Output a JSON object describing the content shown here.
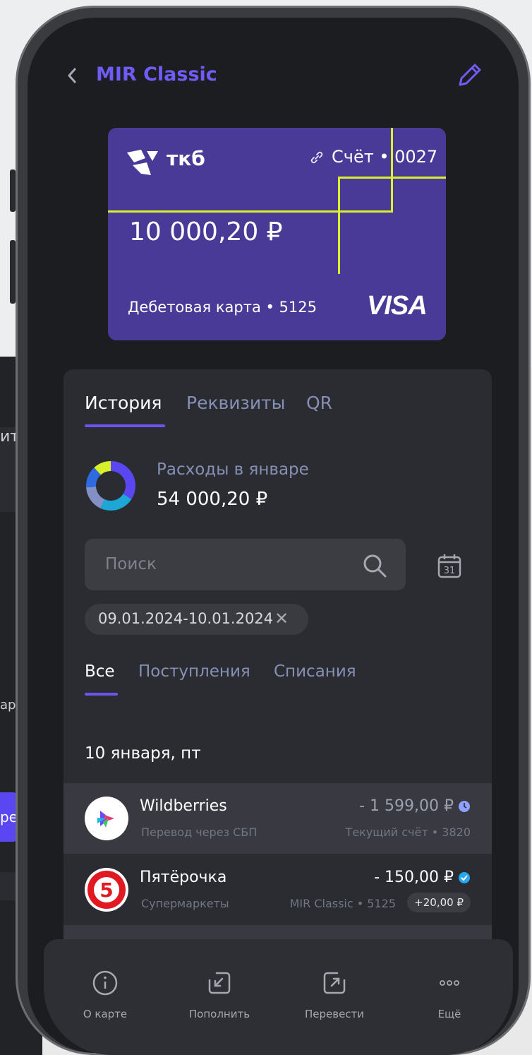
{
  "header": {
    "title": "MIR Classic"
  },
  "card": {
    "bank_name": "ткб",
    "account": "Счёт • 0027",
    "balance": "10 000,20 ₽",
    "type": "Дебетовая карта • 5125",
    "network": "VISA"
  },
  "tabs": [
    {
      "label": "История",
      "active": true
    },
    {
      "label": "Реквизиты",
      "active": false
    },
    {
      "label": "QR",
      "active": false
    }
  ],
  "expenses": {
    "label": "Расходы в январе",
    "value": "54 000,20 ₽"
  },
  "search": {
    "placeholder": "Поиск"
  },
  "date_chip": "09.01.2024-10.01.2024",
  "filter_tabs": [
    {
      "label": "Все",
      "active": true
    },
    {
      "label": "Поступления",
      "active": false
    },
    {
      "label": "Списания",
      "active": false
    }
  ],
  "date_group": "10 января, пт",
  "transactions": [
    {
      "name": "Wildberries",
      "category": "Перевод через СБП",
      "amount": "- 1 599,00 ₽",
      "account": "Текущий счёт • 3820",
      "status": "pending",
      "status_color": "#8fa0ff"
    },
    {
      "name": "Пятёрочка",
      "category": "Супермаркеты",
      "amount": "- 150,00 ₽",
      "account": "MIR Classic • 5125",
      "cashback": "+20,00 ₽",
      "status": "done",
      "status_color": "#28a8f0"
    }
  ],
  "bottom_nav": [
    {
      "label": "О карте",
      "icon": "info-icon"
    },
    {
      "label": "Пополнить",
      "icon": "top-up-icon"
    },
    {
      "label": "Перевести",
      "icon": "transfer-icon"
    },
    {
      "label": "Ещё",
      "icon": "more-icon"
    }
  ],
  "background": {
    "partial_text_1": "ит",
    "partial_text_2": "ар",
    "partial_button": "ре"
  },
  "colors": {
    "accent": "#6a55f0",
    "card": "#4a3a98",
    "card_lines": "#d9f12a"
  }
}
